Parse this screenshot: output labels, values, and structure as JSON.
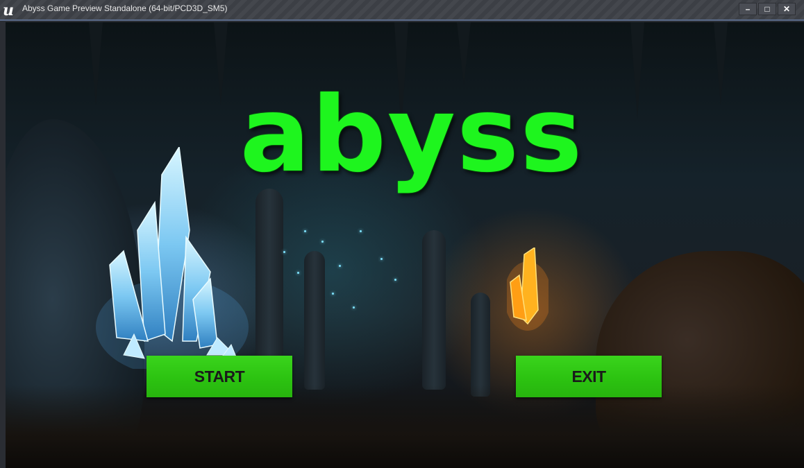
{
  "window": {
    "title": "Abyss Game Preview Standalone (64-bit/PCD3D_SM5)",
    "logo_glyph": "u",
    "minimize_glyph": "–",
    "maximize_glyph": "□",
    "close_glyph": "✕"
  },
  "game": {
    "logo_text": "abyss",
    "logo_color": "#1ef51e",
    "button_color": "#2cc311"
  },
  "menu": {
    "start_label": "START",
    "exit_label": "EXIT"
  }
}
